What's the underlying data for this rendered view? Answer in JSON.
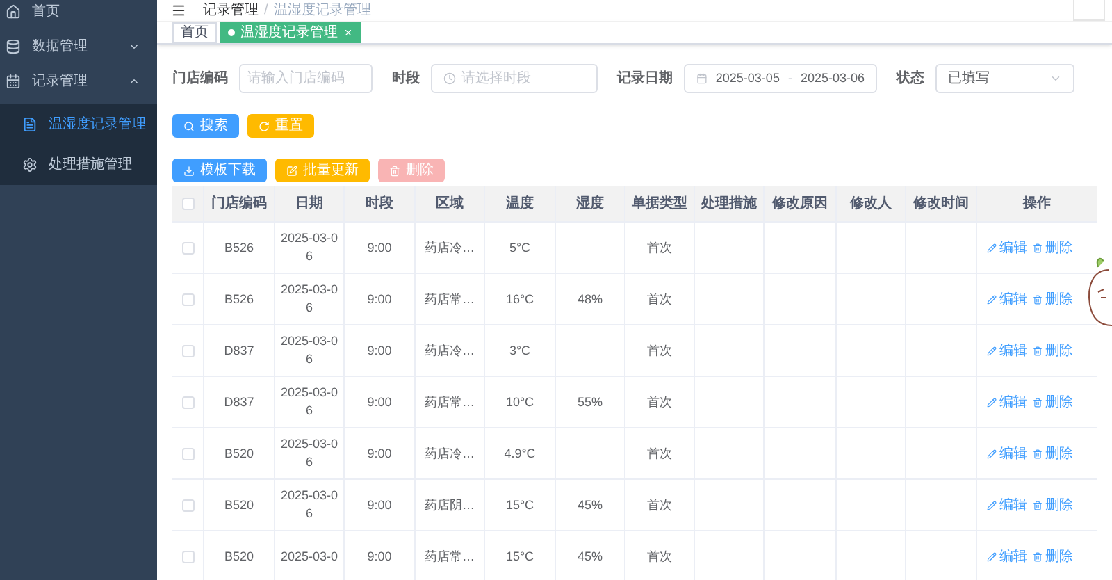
{
  "sidebar": {
    "items": [
      {
        "label": "首页",
        "kind": "home"
      },
      {
        "label": "数据管理",
        "kind": "data",
        "expanded": false
      },
      {
        "label": "记录管理",
        "kind": "calendar",
        "expanded": true,
        "children": [
          {
            "label": "温湿度记录管理",
            "kind": "doc",
            "selected": true
          },
          {
            "label": "处理措施管理",
            "kind": "gear",
            "selected": false
          }
        ]
      }
    ]
  },
  "breadcrumb": [
    "记录管理",
    "温湿度记录管理"
  ],
  "breadcrumb_separator": "/",
  "tags": [
    {
      "label": "首页",
      "selected": false
    },
    {
      "label": "温湿度记录管理",
      "selected": true
    }
  ],
  "filters": [
    {
      "label": "门店编码",
      "kind": "text",
      "placeholder": "请输入门店编码"
    },
    {
      "label": "时段",
      "kind": "time",
      "placeholder": "请选择时段"
    },
    {
      "label": "记录日期",
      "kind": "daterange",
      "start": "2025-03-05",
      "separator": "-",
      "end": "2025-03-06"
    },
    {
      "label": "状态",
      "kind": "select",
      "value": "已填写"
    }
  ],
  "search_buttons": [
    {
      "label": "搜索",
      "kind": "search"
    },
    {
      "label": "重置",
      "kind": "reset"
    }
  ],
  "toolbar": [
    {
      "label": "模板下载",
      "kind": "download",
      "disabled": false
    },
    {
      "label": "批量更新",
      "kind": "update",
      "disabled": false
    },
    {
      "label": "删除",
      "kind": "delete",
      "disabled": true
    }
  ],
  "table": {
    "columns": [
      "门店编码",
      "日期",
      "时段",
      "区域",
      "温度",
      "湿度",
      "单据类型",
      "处理措施",
      "修改原因",
      "修改人",
      "修改时间",
      "操作"
    ],
    "header_checked": false,
    "rows": [
      {
        "checked": false,
        "cells": [
          "B526",
          "2025-03-06",
          "9:00",
          "药店冷…",
          "5°C",
          "",
          "首次",
          "",
          "",
          "",
          ""
        ],
        "actions": [
          "编辑",
          "删除"
        ]
      },
      {
        "checked": false,
        "cells": [
          "B526",
          "2025-03-06",
          "9:00",
          "药店常…",
          "16°C",
          "48%",
          "首次",
          "",
          "",
          "",
          ""
        ],
        "actions": [
          "编辑",
          "删除"
        ]
      },
      {
        "checked": false,
        "cells": [
          "D837",
          "2025-03-06",
          "9:00",
          "药店冷…",
          "3°C",
          "",
          "首次",
          "",
          "",
          "",
          ""
        ],
        "actions": [
          "编辑",
          "删除"
        ]
      },
      {
        "checked": false,
        "cells": [
          "D837",
          "2025-03-06",
          "9:00",
          "药店常…",
          "10°C",
          "55%",
          "首次",
          "",
          "",
          "",
          ""
        ],
        "actions": [
          "编辑",
          "删除"
        ]
      },
      {
        "checked": false,
        "cells": [
          "B520",
          "2025-03-06",
          "9:00",
          "药店冷…",
          "4.9°C",
          "",
          "首次",
          "",
          "",
          "",
          ""
        ],
        "actions": [
          "编辑",
          "删除"
        ]
      },
      {
        "checked": false,
        "cells": [
          "B520",
          "2025-03-06",
          "9:00",
          "药店阴…",
          "15°C",
          "45%",
          "首次",
          "",
          "",
          "",
          ""
        ],
        "actions": [
          "编辑",
          "删除"
        ]
      },
      {
        "checked": false,
        "cells": [
          "B520",
          "2025-03-0",
          "9:00",
          "药店常…",
          "15°C",
          "45%",
          "首次",
          "",
          "",
          "",
          ""
        ],
        "actions": [
          "编辑",
          "删除"
        ]
      }
    ]
  }
}
